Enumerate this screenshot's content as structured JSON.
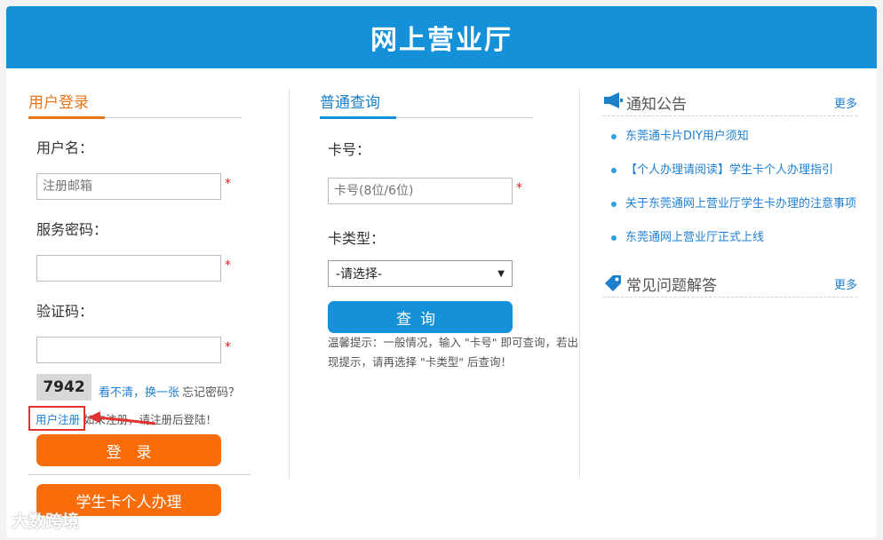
{
  "header": {
    "title": "网上营业厅"
  },
  "login": {
    "section_title": "用户登录",
    "username_label": "用户名：",
    "username_placeholder": "注册邮箱",
    "password_label": "服务密码：",
    "captcha_label": "验证码：",
    "required_mark": "*",
    "captcha_text": "7942",
    "refresh_captcha_link": "看不清，换一张",
    "forgot_password_link": "忘记密码？",
    "register_link": "用户注册",
    "register_hint": "如未注册，请注册后登陆！",
    "login_button": "登　录",
    "student_card_button": "学生卡个人办理"
  },
  "query": {
    "section_title": "普通查询",
    "card_label": "卡号：",
    "card_placeholder": "卡号(8位/6位)",
    "card_type_label": "卡类型：",
    "card_type_selected": "-请选择-",
    "query_button": "查询",
    "hint": "温馨提示：一般情况，输入 \"卡号\" 即可查询，若出现提示，请再选择 \"卡类型\" 后查询！"
  },
  "notices": {
    "title": "通知公告",
    "more": "更多",
    "items": [
      "东莞通卡片DIY用户须知",
      "【个人办理请阅读】学生卡个人办理指引",
      "关于东莞通网上营业厅学生卡办理的注意事项",
      "东莞通网上营业厅正式上线"
    ]
  },
  "faq": {
    "title": "常见问题解答",
    "more": "更多"
  },
  "watermark": "大数跨境",
  "colors": {
    "brand_blue": "#1591da",
    "accent_orange": "#f86d0a",
    "required_red": "#e02020",
    "link_blue": "#1e7fd1"
  }
}
